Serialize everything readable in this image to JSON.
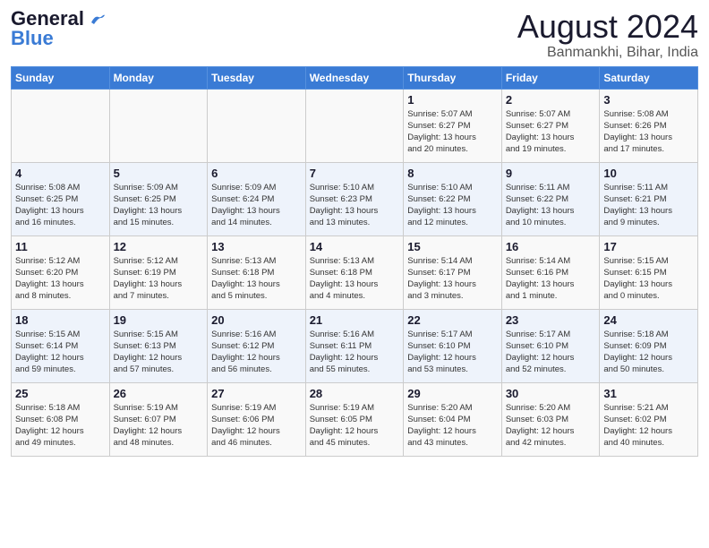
{
  "header": {
    "logo_line1": "General",
    "logo_line2": "Blue",
    "title": "August 2024",
    "subtitle": "Banmankhi, Bihar, India"
  },
  "days_of_week": [
    "Sunday",
    "Monday",
    "Tuesday",
    "Wednesday",
    "Thursday",
    "Friday",
    "Saturday"
  ],
  "weeks": [
    [
      {
        "day": "",
        "info": ""
      },
      {
        "day": "",
        "info": ""
      },
      {
        "day": "",
        "info": ""
      },
      {
        "day": "",
        "info": ""
      },
      {
        "day": "1",
        "info": "Sunrise: 5:07 AM\nSunset: 6:27 PM\nDaylight: 13 hours\nand 20 minutes."
      },
      {
        "day": "2",
        "info": "Sunrise: 5:07 AM\nSunset: 6:27 PM\nDaylight: 13 hours\nand 19 minutes."
      },
      {
        "day": "3",
        "info": "Sunrise: 5:08 AM\nSunset: 6:26 PM\nDaylight: 13 hours\nand 17 minutes."
      }
    ],
    [
      {
        "day": "4",
        "info": "Sunrise: 5:08 AM\nSunset: 6:25 PM\nDaylight: 13 hours\nand 16 minutes."
      },
      {
        "day": "5",
        "info": "Sunrise: 5:09 AM\nSunset: 6:25 PM\nDaylight: 13 hours\nand 15 minutes."
      },
      {
        "day": "6",
        "info": "Sunrise: 5:09 AM\nSunset: 6:24 PM\nDaylight: 13 hours\nand 14 minutes."
      },
      {
        "day": "7",
        "info": "Sunrise: 5:10 AM\nSunset: 6:23 PM\nDaylight: 13 hours\nand 13 minutes."
      },
      {
        "day": "8",
        "info": "Sunrise: 5:10 AM\nSunset: 6:22 PM\nDaylight: 13 hours\nand 12 minutes."
      },
      {
        "day": "9",
        "info": "Sunrise: 5:11 AM\nSunset: 6:22 PM\nDaylight: 13 hours\nand 10 minutes."
      },
      {
        "day": "10",
        "info": "Sunrise: 5:11 AM\nSunset: 6:21 PM\nDaylight: 13 hours\nand 9 minutes."
      }
    ],
    [
      {
        "day": "11",
        "info": "Sunrise: 5:12 AM\nSunset: 6:20 PM\nDaylight: 13 hours\nand 8 minutes."
      },
      {
        "day": "12",
        "info": "Sunrise: 5:12 AM\nSunset: 6:19 PM\nDaylight: 13 hours\nand 7 minutes."
      },
      {
        "day": "13",
        "info": "Sunrise: 5:13 AM\nSunset: 6:18 PM\nDaylight: 13 hours\nand 5 minutes."
      },
      {
        "day": "14",
        "info": "Sunrise: 5:13 AM\nSunset: 6:18 PM\nDaylight: 13 hours\nand 4 minutes."
      },
      {
        "day": "15",
        "info": "Sunrise: 5:14 AM\nSunset: 6:17 PM\nDaylight: 13 hours\nand 3 minutes."
      },
      {
        "day": "16",
        "info": "Sunrise: 5:14 AM\nSunset: 6:16 PM\nDaylight: 13 hours\nand 1 minute."
      },
      {
        "day": "17",
        "info": "Sunrise: 5:15 AM\nSunset: 6:15 PM\nDaylight: 13 hours\nand 0 minutes."
      }
    ],
    [
      {
        "day": "18",
        "info": "Sunrise: 5:15 AM\nSunset: 6:14 PM\nDaylight: 12 hours\nand 59 minutes."
      },
      {
        "day": "19",
        "info": "Sunrise: 5:15 AM\nSunset: 6:13 PM\nDaylight: 12 hours\nand 57 minutes."
      },
      {
        "day": "20",
        "info": "Sunrise: 5:16 AM\nSunset: 6:12 PM\nDaylight: 12 hours\nand 56 minutes."
      },
      {
        "day": "21",
        "info": "Sunrise: 5:16 AM\nSunset: 6:11 PM\nDaylight: 12 hours\nand 55 minutes."
      },
      {
        "day": "22",
        "info": "Sunrise: 5:17 AM\nSunset: 6:10 PM\nDaylight: 12 hours\nand 53 minutes."
      },
      {
        "day": "23",
        "info": "Sunrise: 5:17 AM\nSunset: 6:10 PM\nDaylight: 12 hours\nand 52 minutes."
      },
      {
        "day": "24",
        "info": "Sunrise: 5:18 AM\nSunset: 6:09 PM\nDaylight: 12 hours\nand 50 minutes."
      }
    ],
    [
      {
        "day": "25",
        "info": "Sunrise: 5:18 AM\nSunset: 6:08 PM\nDaylight: 12 hours\nand 49 minutes."
      },
      {
        "day": "26",
        "info": "Sunrise: 5:19 AM\nSunset: 6:07 PM\nDaylight: 12 hours\nand 48 minutes."
      },
      {
        "day": "27",
        "info": "Sunrise: 5:19 AM\nSunset: 6:06 PM\nDaylight: 12 hours\nand 46 minutes."
      },
      {
        "day": "28",
        "info": "Sunrise: 5:19 AM\nSunset: 6:05 PM\nDaylight: 12 hours\nand 45 minutes."
      },
      {
        "day": "29",
        "info": "Sunrise: 5:20 AM\nSunset: 6:04 PM\nDaylight: 12 hours\nand 43 minutes."
      },
      {
        "day": "30",
        "info": "Sunrise: 5:20 AM\nSunset: 6:03 PM\nDaylight: 12 hours\nand 42 minutes."
      },
      {
        "day": "31",
        "info": "Sunrise: 5:21 AM\nSunset: 6:02 PM\nDaylight: 12 hours\nand 40 minutes."
      }
    ]
  ]
}
